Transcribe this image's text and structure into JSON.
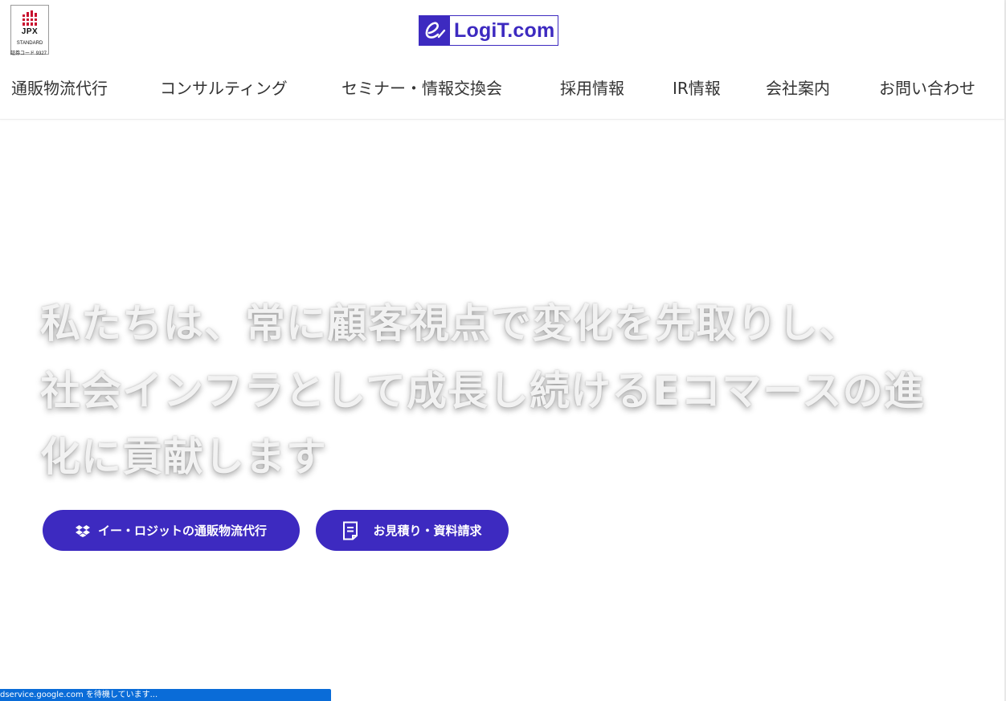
{
  "header": {
    "jpx_badge": {
      "mark_icon": "jpx-bars-icon",
      "name": "JPX",
      "standard": "STANDARD",
      "code": "証券コード 9327"
    },
    "logo": {
      "prefix_icon": "e-script-icon",
      "text": "LogiT.com",
      "color": "#3d2ac0"
    },
    "nav": [
      {
        "label": "通販物流代行"
      },
      {
        "label": "コンサルティング"
      },
      {
        "label": "セミナー・情報交換会"
      },
      {
        "label": "採用情報"
      },
      {
        "label": "IR情報"
      },
      {
        "label": "会社案内"
      },
      {
        "label": "お問い合わせ"
      }
    ]
  },
  "hero": {
    "lines": [
      "私たちは、常に顧客視点で変化を先取りし、",
      "社会インフラとして成長し続けるEコマースの進",
      "化に貢献します"
    ],
    "buttons": [
      {
        "label": "イー・ロジットの通販物流代行",
        "icon": "dropbox-icon"
      },
      {
        "label": "お見積り・資料請求",
        "icon": "document-icon"
      }
    ]
  },
  "status_bar": {
    "text": "dservice.google.com を待機しています..."
  },
  "colors": {
    "accent": "#3d2ac0",
    "status_bar": "#0a6cd8",
    "nav_text": "#333333"
  }
}
